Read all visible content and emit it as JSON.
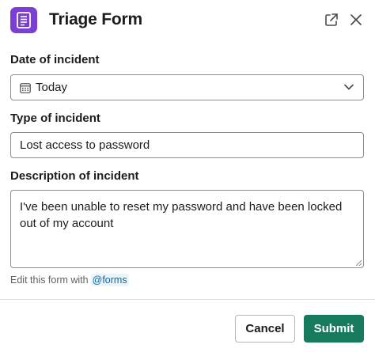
{
  "header": {
    "title": "Triage Form",
    "app_icon": "form-document-icon",
    "app_icon_color": "#7c3fd6",
    "popout_icon": "external-link-icon",
    "close_icon": "close-icon"
  },
  "form": {
    "date": {
      "label": "Date of incident",
      "value": "Today",
      "icon": "calendar-icon"
    },
    "type": {
      "label": "Type of incident",
      "value": "Lost access to password"
    },
    "description": {
      "label": "Description of incident",
      "value": "I've been unable to reset my password and have been locked out of my account"
    },
    "helper": {
      "text": "Edit this form with",
      "mention": "@forms"
    }
  },
  "footer": {
    "cancel_label": "Cancel",
    "submit_label": "Submit",
    "submit_color": "#157b5b"
  }
}
